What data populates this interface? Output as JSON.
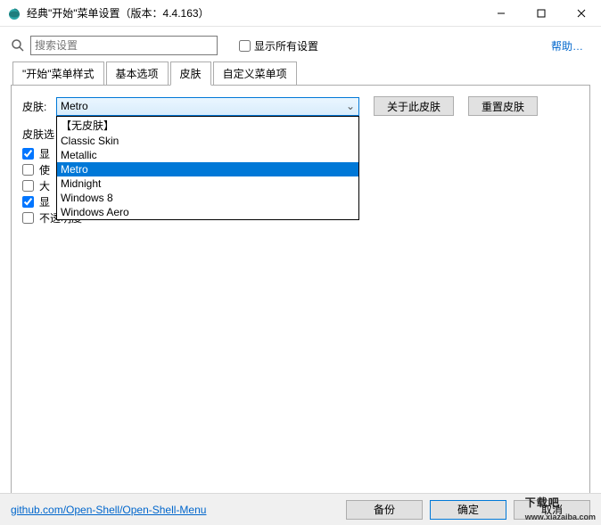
{
  "window": {
    "title": "经典\"开始\"菜单设置（版本：4.4.163）"
  },
  "toolbar": {
    "search_placeholder": "搜索设置",
    "show_all_label": "显示所有设置",
    "help_label": "帮助…"
  },
  "tabs": [
    "\"开始\"菜单样式",
    "基本选项",
    "皮肤",
    "自定义菜单项"
  ],
  "active_tab": 2,
  "skin": {
    "label": "皮肤:",
    "selected": "Metro",
    "about_btn": "关于此皮肤",
    "reset_btn": "重置皮肤",
    "options_label": "皮肤选",
    "options": [
      "【无皮肤】",
      "Classic Skin",
      "Metallic",
      "Metro",
      "Midnight",
      "Windows 8",
      "Windows Aero"
    ],
    "highlighted_index": 3
  },
  "checks": [
    {
      "label": "显",
      "checked": true
    },
    {
      "label": "使",
      "checked": false
    },
    {
      "label": "大",
      "checked": false
    },
    {
      "label": "显",
      "checked": true
    },
    {
      "label": "不透明度",
      "checked": false
    }
  ],
  "bottom": {
    "link": "github.com/Open-Shell/Open-Shell-Menu",
    "backup": "备份",
    "ok": "确定",
    "cancel": "取消"
  },
  "watermark": {
    "main": "下载吧",
    "sub": "www.xiazaiba.com"
  }
}
